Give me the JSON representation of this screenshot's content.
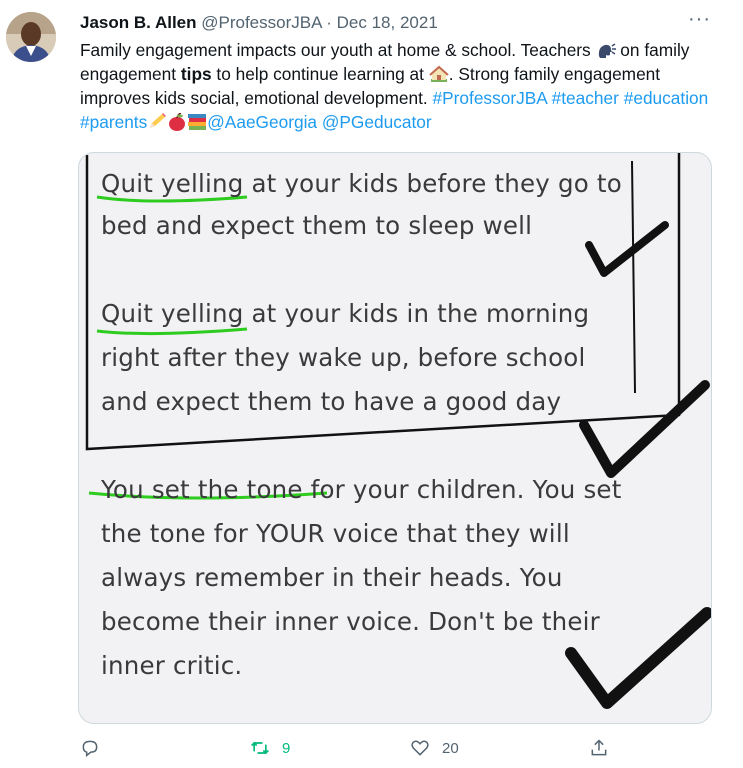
{
  "tweet": {
    "author_name": "Jason B. Allen",
    "handle": "@ProfessorJBA",
    "separator": "·",
    "date": "Dec 18, 2021",
    "text": {
      "t1": "Family engagement impacts our youth at home & school. Teachers ",
      "t2": " on family engagement ",
      "t_bold": "tips",
      "t3": " to help continue learning at ",
      "t4": ". Strong family engagement improves kids social, emotional development. ",
      "h1": "#ProfessorJBA",
      "h2": "#teacher",
      "h3": "#education",
      "h4": "#parents",
      "m1": "@AaeGeorgia",
      "m2": "@PGeducator"
    },
    "emojis": [
      "speaking-head-emoji",
      "house-emoji",
      "pencil-emoji",
      "apple-emoji",
      "books-emoji"
    ]
  },
  "image": {
    "lines": [
      "Quit yelling at your kids before they go to",
      "bed and expect them to sleep well",
      "Quit yelling at your kids in the morning",
      "right after they wake up, before school",
      "and expect them to have a good day",
      "You set the tone for your children.  You set",
      "the tone for YOUR voice that they will",
      "always remember in their heads.  You",
      "become their inner voice.  Don't be their",
      "inner critic."
    ],
    "underline_color": "#2ecc1f"
  },
  "actions": {
    "reply_count": "",
    "retweet_count": "9",
    "like_count": "20",
    "retweet_color": "#00ba7c"
  }
}
